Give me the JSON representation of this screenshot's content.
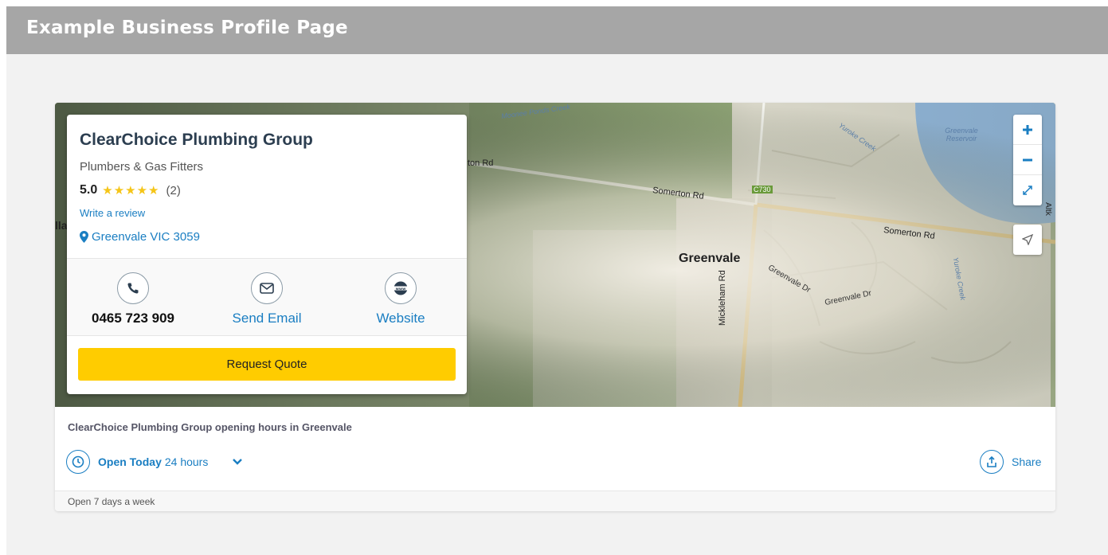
{
  "page": {
    "header_title": "Example Business Profile Page"
  },
  "business": {
    "name": "ClearChoice Plumbing Group",
    "category": "Plumbers & Gas Fitters",
    "rating_score": "5.0",
    "stars": "★★★★★",
    "rating_value": 5,
    "review_count": "(2)",
    "write_review_label": "Write a review",
    "location": "Greenvale VIC 3059"
  },
  "actions": {
    "phone": "0465 723 909",
    "email_label": "Send Email",
    "website_label": "Website",
    "request_quote_label": "Request Quote"
  },
  "map": {
    "labels": {
      "greenvale": "Greenvale",
      "somerton_rd_1": "Somerton Rd",
      "somerton_rd_2": "Somerton Rd",
      "on_rd": "ton Rd",
      "mickleham_rd": "Mickleham Rd",
      "greenvale_dr_1": "Greenvale Dr",
      "greenvale_dr_2": "Greenvale Dr",
      "c730": "C730",
      "moonee_ponds_creek": "Moonee Ponds Creek",
      "yuroke_creek_1": "Yuroke Creek",
      "yuroke_creek_2": "Yuroke Creek",
      "reservoir": "Greenvale Reservoir",
      "altk": "Altk",
      "lla": "lla"
    },
    "controls": {
      "zoom_in": "+",
      "zoom_out": "−"
    }
  },
  "hours": {
    "title": "ClearChoice Plumbing Group opening hours in Greenvale",
    "open_status": "Open Today",
    "open_time": "24 hours",
    "share_label": "Share",
    "footer_note": "Open 7 days a week"
  },
  "colors": {
    "header_bg": "#a6a6a6",
    "accent_blue": "#1a7ec2",
    "quote_yellow": "#ffcc00",
    "star_yellow": "#f5c518"
  }
}
